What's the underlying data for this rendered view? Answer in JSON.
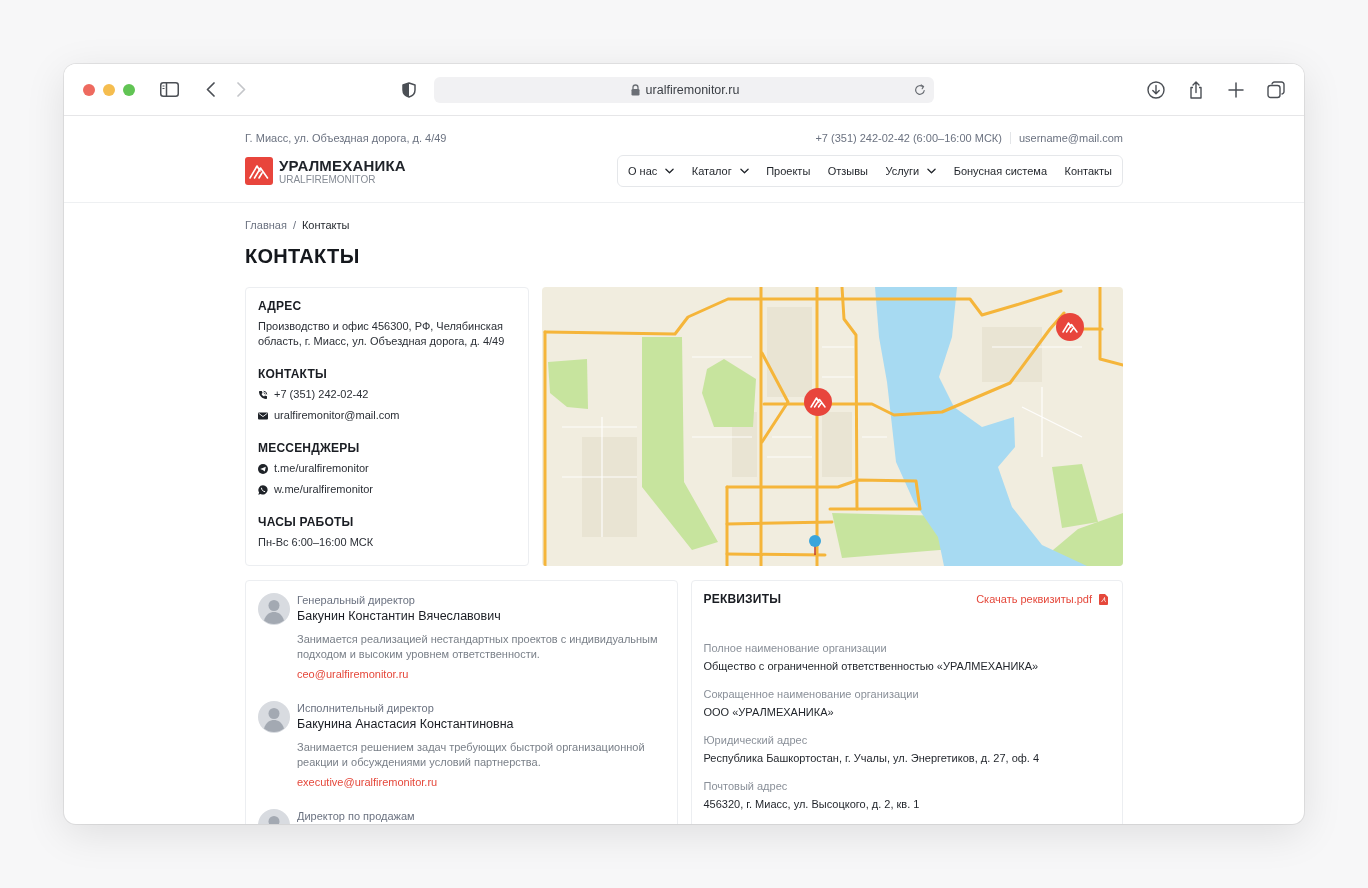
{
  "browser": {
    "url": "uralfiremonitor.ru",
    "back_disabled": false,
    "forward_disabled": true
  },
  "topbar": {
    "address": "Г. Миасс, ул. Объездная дорога, д. 4/49",
    "phone": "+7 (351) 242-02-42 (6:00–16:00 МСК)",
    "email": "username@mail.com"
  },
  "logo": {
    "name": "УРАЛМЕХАНИКА",
    "subtitle": "URALFIREMONITOR"
  },
  "nav": [
    {
      "label": "О нас",
      "dropdown": true
    },
    {
      "label": "Каталог",
      "dropdown": true
    },
    {
      "label": "Проекты",
      "dropdown": false
    },
    {
      "label": "Отзывы",
      "dropdown": false
    },
    {
      "label": "Услуги",
      "dropdown": true
    },
    {
      "label": "Бонусная система",
      "dropdown": false
    },
    {
      "label": "Контакты",
      "dropdown": false
    }
  ],
  "breadcrumbs": {
    "separator": "/",
    "items": [
      {
        "label": "Главная",
        "current": false
      },
      {
        "label": "Контакты",
        "current": true
      }
    ]
  },
  "page_title": "КОНТАКТЫ",
  "contact_card": {
    "sections": [
      {
        "title": "АДРЕС",
        "items": [
          {
            "kind": "text",
            "text": "Производство и офис 456300, РФ, Челябинская область, г. Миасс, ул. Объездная дорога, д. 4/49"
          }
        ]
      },
      {
        "title": "КОНТАКТЫ",
        "items": [
          {
            "kind": "phone",
            "text": "+7 (351) 242-02-42"
          },
          {
            "kind": "email",
            "text": "uralfiremonitor@mail.com"
          }
        ]
      },
      {
        "title": "МЕССЕНДЖЕРЫ",
        "items": [
          {
            "kind": "telegram",
            "text": "t.me/uralfiremonitor"
          },
          {
            "kind": "whatsapp",
            "text": "w.me/uralfiremonitor"
          }
        ]
      },
      {
        "title": "ЧАСЫ РАБОТЫ",
        "items": [
          {
            "kind": "text",
            "text": "Пн-Вс 6:00–16:00 МСК"
          }
        ]
      }
    ]
  },
  "team": [
    {
      "role": "Генеральный директор",
      "name": "Бакунин Константин Вячеславович",
      "description": "Занимается реализацией нестандартных проектов с индивидуальным подходом и высоким уровнем ответственности.",
      "email": "ceo@uralfiremonitor.ru"
    },
    {
      "role": "Исполнительный директор",
      "name": "Бакунина Анастасия Константиновна",
      "description": "Занимается решением задач требующих быстрой организационной реакции и обсуждениями условий партнерства.",
      "email": "executive@uralfiremonitor.ru"
    },
    {
      "role": "Директор по продажам"
    }
  ],
  "requisites": {
    "title": "РЕКВИЗИТЫ",
    "download": "Скачать реквизиты.pdf",
    "fields": [
      {
        "label": "Полное наименование организации",
        "value": "Общество с ограниченной ответственностью «УРАЛМЕХАНИКА»"
      },
      {
        "label": "Сокращенное наименование организации",
        "value": "ООО «УРАЛМЕХАНИКА»"
      },
      {
        "label": "Юридический адрес",
        "value": "Республика Башкортостан, г. Учалы, ул. Энергетиков, д. 27, оф. 4"
      },
      {
        "label": "Почтовый адрес",
        "value": "456320, г. Миасс, ул. Высоцкого, д. 2, кв. 1"
      }
    ]
  }
}
